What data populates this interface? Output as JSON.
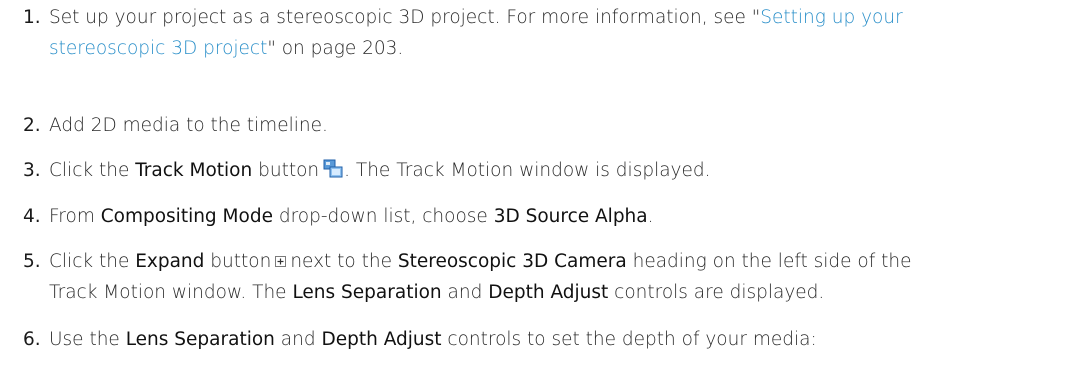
{
  "steps": [
    {
      "number": "1.",
      "line1_prefix": "Set up your project as a stereoscopic 3D project. For more information, see \"",
      "link_line1": "Setting up your",
      "link_line2": "stereoscopic 3D project",
      "line2_suffix": "\" on page 203."
    },
    {
      "number": "2.",
      "text": "Add 2D media to the timeline."
    },
    {
      "number": "3.",
      "pre": "Click the ",
      "bold1": "Track Motion",
      "mid": " button",
      "icon": "track-motion-icon",
      "post": ". The Track Motion window is displayed."
    },
    {
      "number": "4.",
      "pre": "From ",
      "bold1": "Compositing Mode",
      "mid": " drop-down list, choose ",
      "bold2": "3D Source Alpha",
      "post": "."
    },
    {
      "number": "5.",
      "pre": "Click the ",
      "bold1": "Expand",
      "mid1": " button",
      "icon": "expand-icon",
      "mid2": "next to the ",
      "bold2": "Stereoscopic 3D Camera",
      "mid3": " heading on the left side of the",
      "line2_pre": "Track Motion window. The ",
      "bold3": "Lens Separation",
      "line2_mid": " and ",
      "bold4": "Depth Adjust",
      "line2_post": " controls are displayed."
    },
    {
      "number": "6.",
      "pre": "Use the ",
      "bold1": "Lens Separation",
      "mid": " and ",
      "bold2": "Depth Adjust",
      "post": " controls to set the depth of your media:"
    }
  ],
  "colors": {
    "text": "#2a2a2a",
    "link": "#2a8fc9",
    "background": "#ffffff"
  }
}
